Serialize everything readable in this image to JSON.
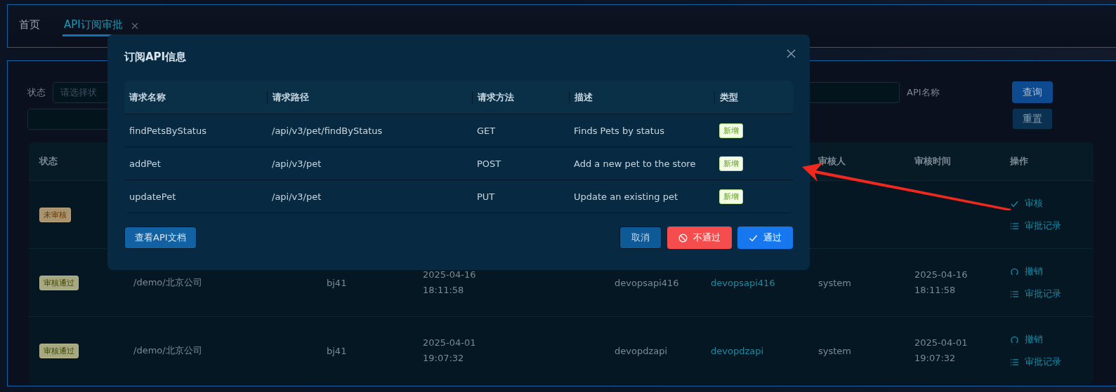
{
  "tabs": [
    {
      "label": "首页",
      "selected": false,
      "closable": false
    },
    {
      "label": "API订阅审批",
      "selected": true,
      "closable": true
    }
  ],
  "filters": {
    "status_label": "状态",
    "status_placeholder": "请选择状",
    "api_name_label": "API名称",
    "query_button": "查询",
    "reset_button": "重置"
  },
  "table": {
    "headers": {
      "status": "状态",
      "reviewer": "审核人",
      "review_time": "审核时间",
      "actions": "操作"
    },
    "rows": [
      {
        "status": {
          "label": "未审核",
          "kind": "pending"
        },
        "actions": [
          {
            "kind": "approve",
            "label": "审核"
          },
          {
            "kind": "history",
            "label": "审批记录"
          }
        ]
      },
      {
        "status": {
          "label": "审核通过",
          "kind": "approved"
        },
        "column_2": "/demo/北京公司",
        "column_3": "bj41",
        "column_4": [
          "2025-04-16",
          "18:11:58"
        ],
        "column_6": "devopsapi416",
        "column_7": "devopsapi416",
        "reviewer": "system",
        "review_time": [
          "2025-04-16",
          "18:11:58"
        ],
        "actions": [
          {
            "kind": "revoke",
            "label": "撤销"
          },
          {
            "kind": "history",
            "label": "审批记录"
          }
        ]
      },
      {
        "status": {
          "label": "审核通过",
          "kind": "approved"
        },
        "column_2": "/demo/北京公司",
        "column_3": "bj41",
        "column_4": [
          "2025-04-01",
          "19:07:32"
        ],
        "column_6": "devopdzapi",
        "column_7": "devopdzapi",
        "reviewer": "system",
        "review_time": [
          "2025-04-01",
          "19:07:32"
        ],
        "actions": [
          {
            "kind": "revoke",
            "label": "撤销"
          },
          {
            "kind": "history",
            "label": "审批记录"
          }
        ]
      }
    ]
  },
  "dialog": {
    "title": "订阅API信息",
    "columns": [
      "请求名称",
      "请求路径",
      "请求方法",
      "描述",
      "类型"
    ],
    "rows": [
      {
        "name": "findPetsByStatus",
        "path": "/api/v3/pet/findByStatus",
        "method": "GET",
        "description": "Finds Pets by status",
        "type": "新增"
      },
      {
        "name": "addPet",
        "path": "/api/v3/pet",
        "method": "POST",
        "description": "Add a new pet to the store",
        "type": "新增"
      },
      {
        "name": "updatePet",
        "path": "/api/v3/pet",
        "method": "PUT",
        "description": "Update an existing pet",
        "type": "新增"
      }
    ],
    "docs_button": "查看API文档",
    "buttons": [
      {
        "kind": "cancel",
        "label": "取消"
      },
      {
        "kind": "reject",
        "label": "不通过"
      },
      {
        "kind": "approve",
        "label": "通过"
      }
    ]
  }
}
